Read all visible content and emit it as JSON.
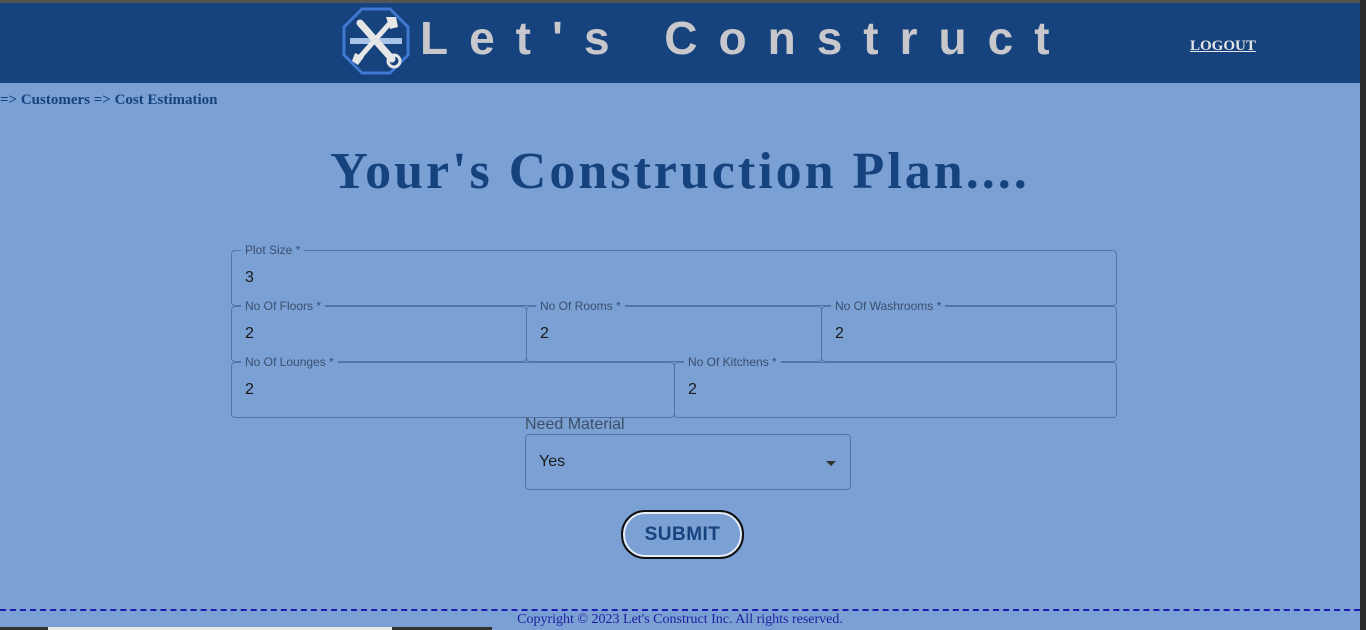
{
  "header": {
    "brand_title": "Let's Construct",
    "logout_label": "LOGOUT",
    "logo_icon": "tools-icon"
  },
  "breadcrumb": "=> Customers => Cost Estimation",
  "page_title": "Your's Construction Plan....",
  "form": {
    "plot_size": {
      "label": "Plot Size *",
      "value": "3"
    },
    "floors": {
      "label": "No Of Floors *",
      "value": "2"
    },
    "rooms": {
      "label": "No Of Rooms *",
      "value": "2"
    },
    "washrooms": {
      "label": "No Of Washrooms *",
      "value": "2"
    },
    "lounges": {
      "label": "No Of Lounges *",
      "value": "2"
    },
    "kitchens": {
      "label": "No Of Kitchens *",
      "value": "2"
    },
    "need_material": {
      "label": "Need Material",
      "value": "Yes"
    },
    "submit_label": "SUBMIT"
  },
  "footer": {
    "copyright": "Copyright © 2023 Let's Construct Inc. All rights reserved."
  },
  "colors": {
    "background": "#7aa0d4",
    "header": "#16427d",
    "title": "#16427d"
  }
}
